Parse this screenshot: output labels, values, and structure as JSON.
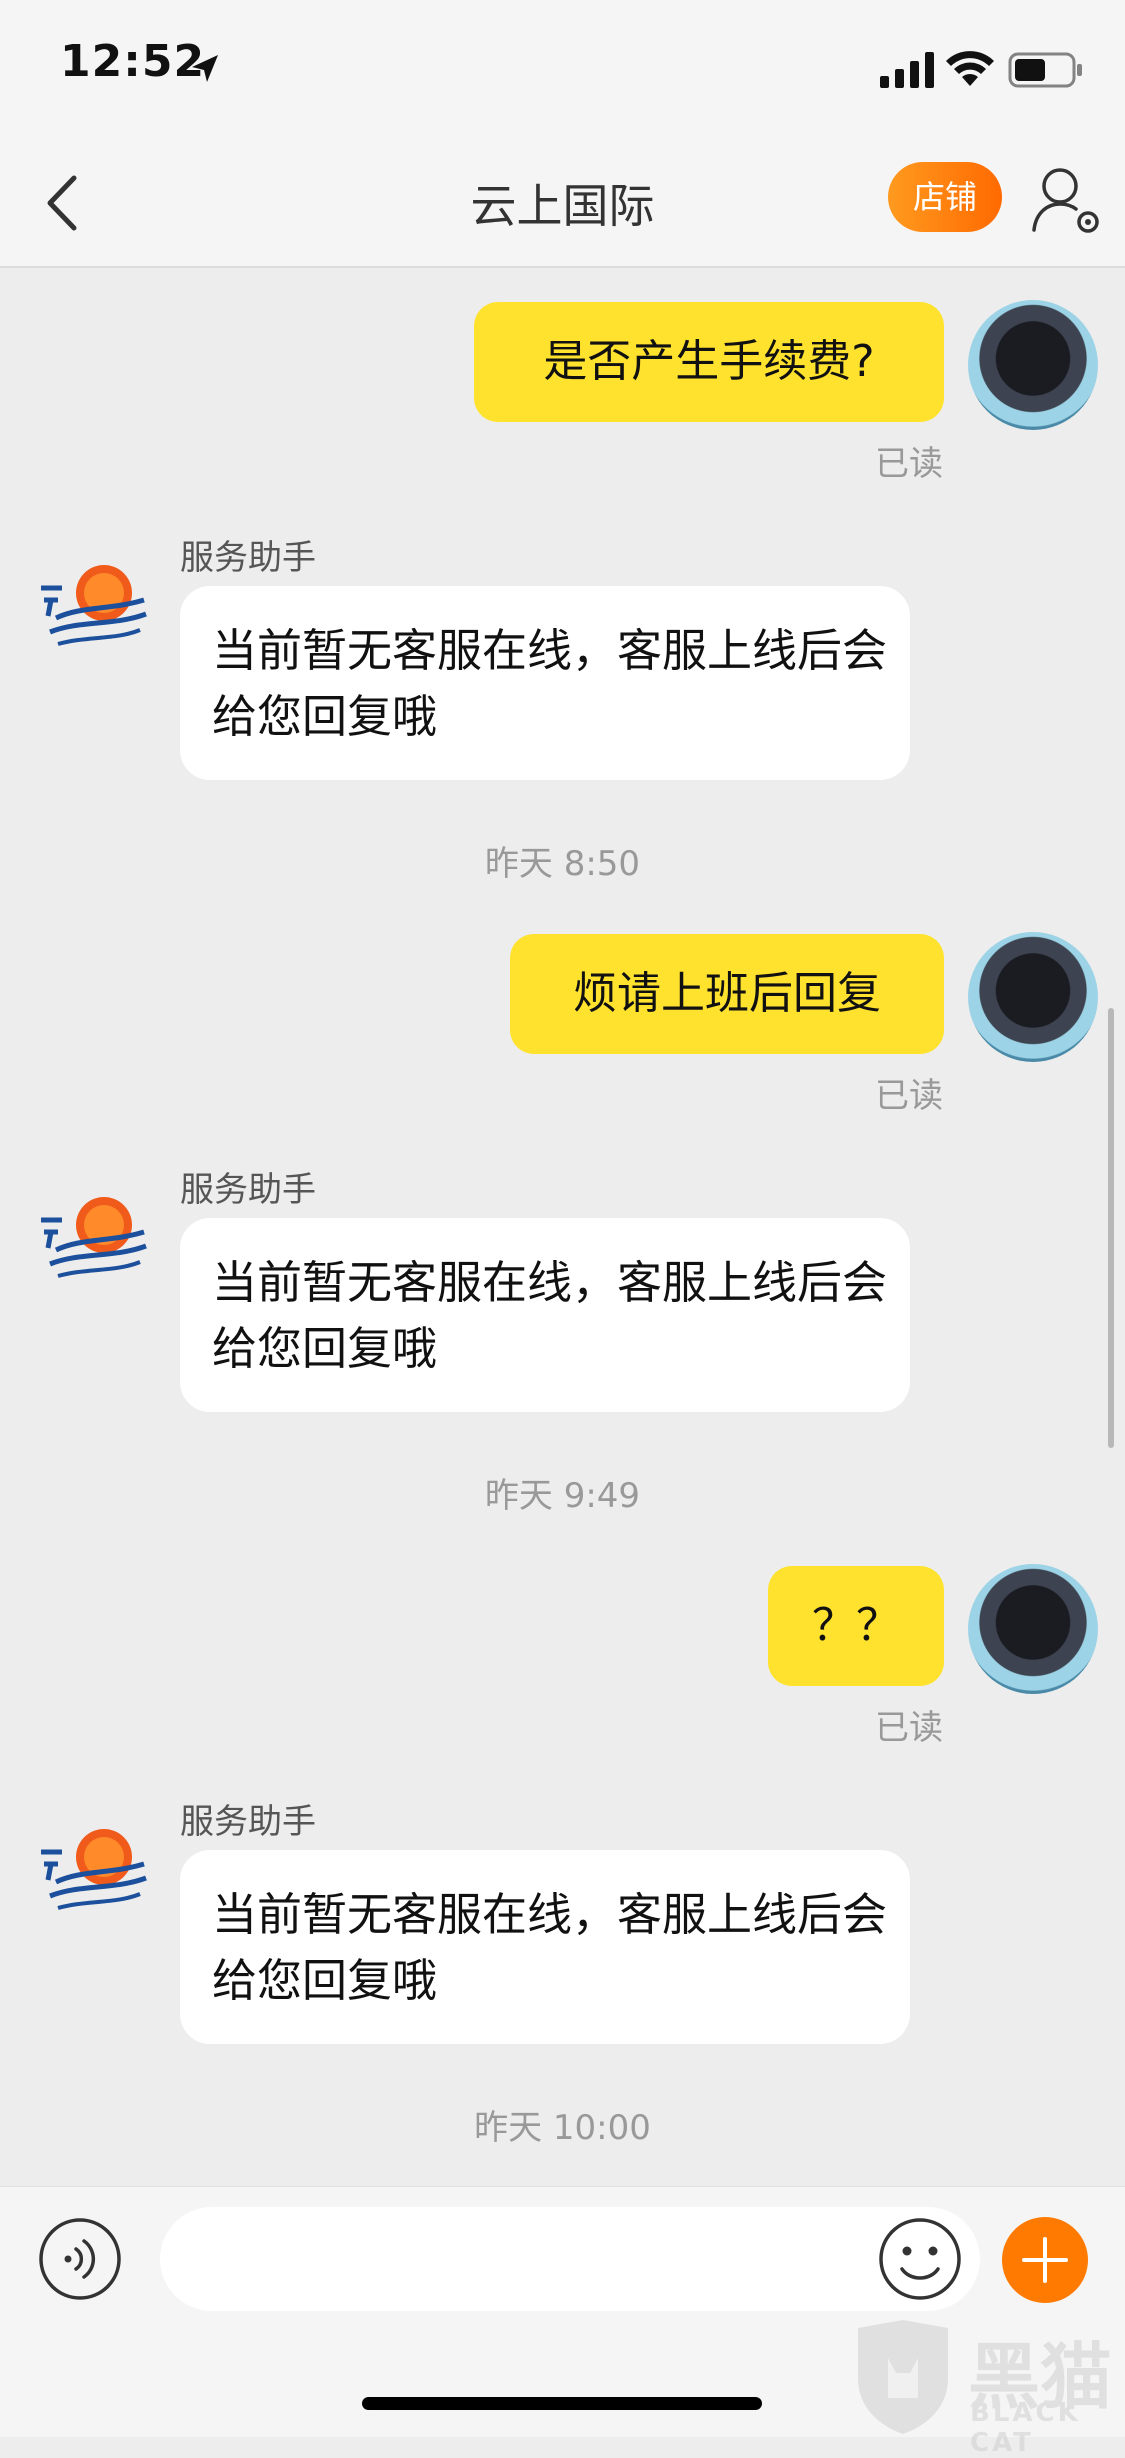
{
  "status_bar": {
    "time": "12:52"
  },
  "nav": {
    "title": "云上国际",
    "shop_label": "店铺"
  },
  "messages": [
    {
      "from": "me",
      "text": "是否产生手续费?",
      "read": "已读"
    },
    {
      "from": "bot",
      "name": "服务助手",
      "text": "当前暂无客服在线，客服上线后会给您回复哦"
    },
    {
      "timestamp": "昨天 8:50"
    },
    {
      "from": "me",
      "text": "烦请上班后回复",
      "read": "已读"
    },
    {
      "from": "bot",
      "name": "服务助手",
      "text": "当前暂无客服在线，客服上线后会给您回复哦"
    },
    {
      "timestamp": "昨天 9:49"
    },
    {
      "from": "me",
      "text": "？？",
      "read": "已读"
    },
    {
      "from": "bot",
      "name": "服务助手",
      "text": "当前暂无客服在线，客服上线后会给您回复哦"
    },
    {
      "timestamp": "昨天 10:00"
    }
  ],
  "input": {
    "value": "",
    "placeholder": ""
  },
  "watermark": {
    "text": "黑猫",
    "sub": "BLACK CAT"
  },
  "colors": {
    "my_bubble": "#ffe22e",
    "accent": "#ff7a00",
    "background": "#ededed"
  }
}
